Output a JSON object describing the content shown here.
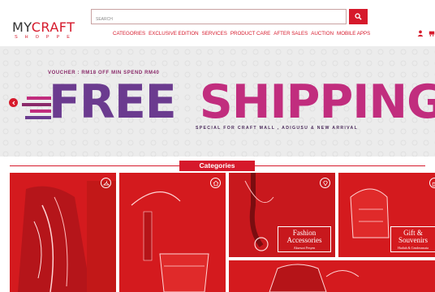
{
  "logo": {
    "top_plain": "MY",
    "top_accent": "CRAFT",
    "bottom": "SHOPPE"
  },
  "search": {
    "placeholder": "SEARCH"
  },
  "nav": {
    "items": [
      "CATEGORIES",
      "EXCLUSIVE EDITION",
      "SERVICES",
      "PRODUCT CARE",
      "AFTER SALES",
      "AUCTION",
      "MOBILE APPS"
    ]
  },
  "header_icons": [
    "user-icon",
    "cart-icon"
  ],
  "banner": {
    "voucher": "VOUCHER : RM18 OFF MIN SPEND RM40",
    "headline_word1": "FREE",
    "headline_word2": "SHIPPING",
    "subline": "SPECIAL FOR CRAFT MALL , ADIGUSU & NEW ARRIVAL"
  },
  "categories": {
    "title": "Categories",
    "tiles": [
      {
        "icon": "hanger-icon"
      },
      {
        "icon": "home-icon"
      },
      {
        "icon": "gem-icon",
        "label": "Fashion Accessories",
        "sub": "Aksesori Fesyen"
      },
      {
        "icon": "gift-icon",
        "label": "Gift & Souvenirs",
        "sub": "Hadiah & Cenderamata"
      },
      {
        "icon": ""
      }
    ]
  },
  "colors": {
    "brand_red": "#d6192b",
    "tile_red": "#d81c20",
    "banner_bg": "#ececec",
    "headline_purple": "#6b3b8f",
    "headline_magenta": "#c12d7e"
  }
}
